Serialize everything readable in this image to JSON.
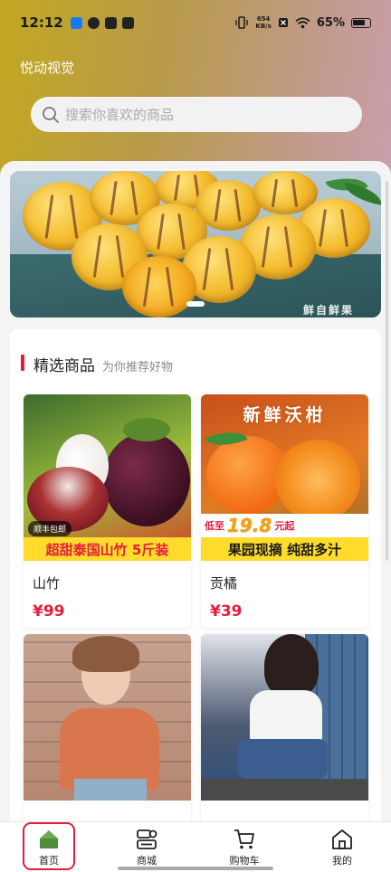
{
  "status_bar": {
    "time": "12:12",
    "net_speed_value": "654",
    "net_speed_unit": "KB/s",
    "battery": "65%"
  },
  "app": {
    "title": "悦动视觉"
  },
  "search": {
    "placeholder": "搜索你喜欢的商品"
  },
  "banner": {
    "box_text": "鲜自鲜果"
  },
  "section": {
    "title": "精选商品",
    "subtitle": "为你推荐好物"
  },
  "products": [
    {
      "name": "山竹",
      "price": "¥99",
      "badge": "顺丰包邮",
      "strip": "超甜泰国山竹 5斤装"
    },
    {
      "name": "贡橘",
      "price": "¥39",
      "headline": "新鲜沃柑",
      "promo_prefix": "低至",
      "promo_value": "19.8",
      "promo_suffix": "元起",
      "strip": "果园现摘 纯甜多汁"
    },
    {
      "name": "",
      "price": ""
    },
    {
      "name": "",
      "price": ""
    }
  ],
  "tabs": [
    {
      "label": "首页",
      "icon": "home-icon",
      "active": true
    },
    {
      "label": "商城",
      "icon": "store-icon"
    },
    {
      "label": "购物车",
      "icon": "cart-icon"
    },
    {
      "label": "我的",
      "icon": "profile-house-icon"
    }
  ],
  "colors": {
    "accent": "#e51c3c",
    "header_start": "#c2a821",
    "header_end": "#c9a0b0"
  }
}
